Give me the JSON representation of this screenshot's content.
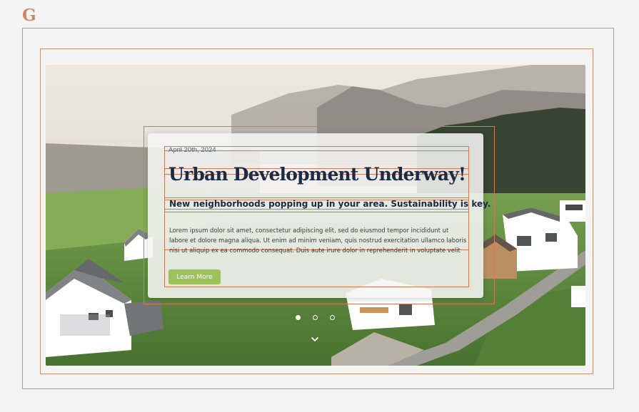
{
  "brand": {
    "logo_letter": "G"
  },
  "slide": {
    "date": "April 20th, 2024",
    "headline": "Urban Development Underway!",
    "subheadline": "New neighborhoods popping up in your area. Sustainability is key.",
    "body": "Lorem ipsum dolor sit amet, consectetur adipiscing elit, sed do eiusmod tempor incididunt ut labore et dolore magna aliqua. Ut enim ad minim veniam, quis nostrud exercitation ullamco laboris nisi ut aliquip ex ea commodo consequat. Duis aute irure dolor in reprehenderit in voluptate velit esse cillum dolore...",
    "button_label": "Learn More"
  },
  "carousel": {
    "total_slides": 3,
    "active_index": 0
  },
  "colors": {
    "accent": "#c8896a",
    "button": "#9dc15b",
    "headline": "#1d2a44"
  },
  "icons": {
    "scroll": "chevron-down-icon"
  }
}
